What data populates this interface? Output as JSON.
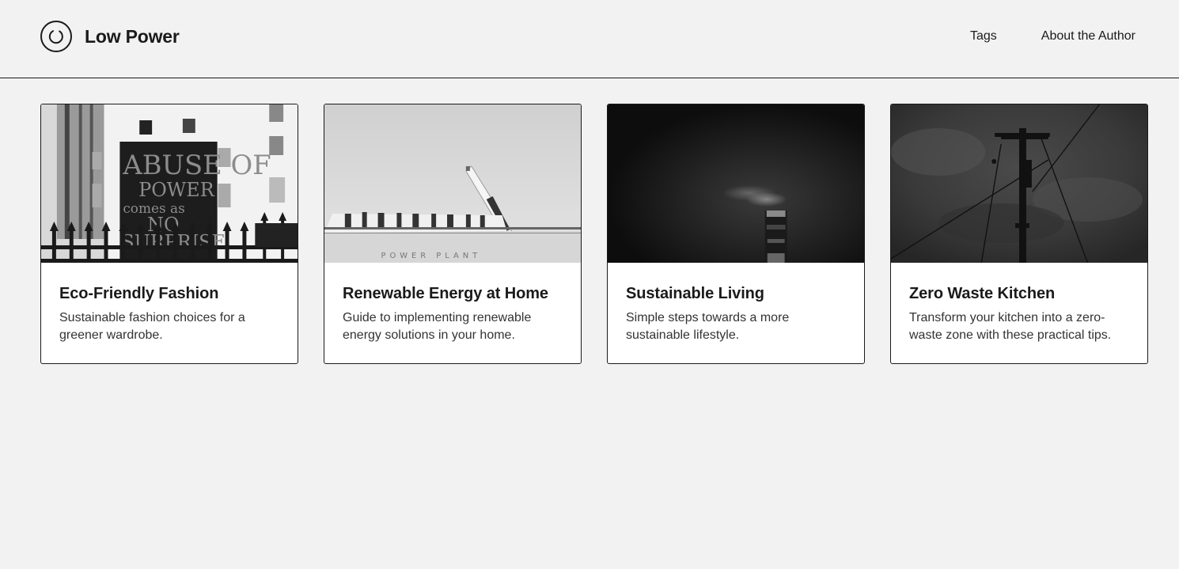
{
  "site": {
    "title": "Low Power",
    "logo_icon": "power-cycle-icon"
  },
  "nav": {
    "items": [
      {
        "label": "Tags"
      },
      {
        "label": "About the Author"
      }
    ]
  },
  "cards": [
    {
      "title": "Eco-Friendly Fashion",
      "description": "Sustainable fashion choices for a greener wardrobe.",
      "image_alt": "protest sign reading abuse of power comes as no surprise",
      "sign_text": "ABUSE OF POWER comes as NO SURPRISE"
    },
    {
      "title": "Renewable Energy at Home",
      "description": "Guide to implementing renewable energy solutions in your home.",
      "image_alt": "power plant building with chimney",
      "building_text": "POWER PLANT"
    },
    {
      "title": "Sustainable Living",
      "description": "Simple steps towards a more sustainable lifestyle.",
      "image_alt": "smoking chimney at night"
    },
    {
      "title": "Zero Waste Kitchen",
      "description": "Transform your kitchen into a zero-waste zone with these practical tips.",
      "image_alt": "utility pole against cloudy sky"
    }
  ]
}
